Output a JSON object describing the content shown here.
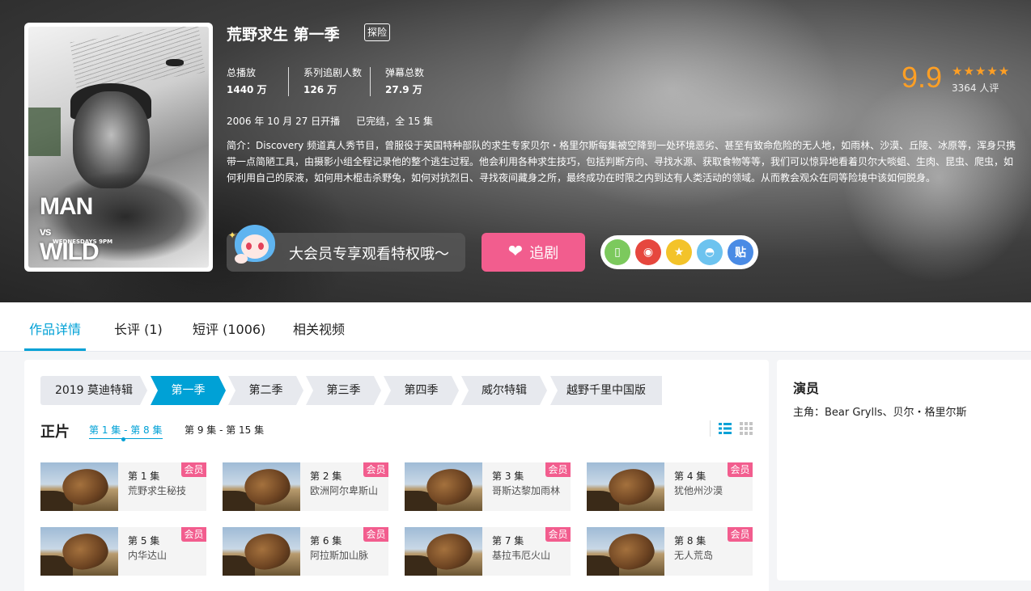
{
  "show": {
    "title": "荒野求生 第一季",
    "genre_tag": "探险",
    "stats": [
      {
        "label": "总播放",
        "value": "1440 万"
      },
      {
        "label": "系列追剧人数",
        "value": "126 万"
      },
      {
        "label": "弹幕总数",
        "value": "27.9 万"
      }
    ],
    "premiere": "2006 年 10 月 27 日开播",
    "status": "已完结，全 15 集",
    "intro": "简介：Discovery 频道真人秀节目，曾服役于英国特种部队的求生专家贝尔・格里尔斯每集被空降到一处环境恶劣、甚至有致命危险的无人地，如雨林、沙漠、丘陵、冰原等，浑身只携带一点简陋工具，由摄影小组全程记录他的整个逃生过程。他会利用各种求生技巧，包括判断方向、寻找水源、获取食物等等，我们可以惊异地看着贝尔大啖蛆、生肉、昆虫、爬虫，如何利用自己的尿液，如何用木棍击杀野兔，如何对抗烈日、寻找夜间藏身之所，最终成功在时限之内到达有人类活动的领域。从而教会观众在同等险境中该如何脱身。",
    "poster": {
      "title_line1": "MAN",
      "title_line2": "vs",
      "title_line3": "WILD",
      "tagline": "WEDNESDAYS 9PM"
    }
  },
  "rating": {
    "score": "9.9",
    "stars": "★★★★★",
    "count": "3364 人评"
  },
  "vip_banner": {
    "text": "大会员专享观看特权哦～"
  },
  "follow_button": {
    "label": "追剧",
    "icon": "heart-icon"
  },
  "share": [
    {
      "name": "mobile-share-icon",
      "glyph": "▯",
      "color": "#7cc95d"
    },
    {
      "name": "weibo-share-icon",
      "glyph": "◉",
      "color": "#e6473e"
    },
    {
      "name": "qzone-share-icon",
      "glyph": "★",
      "color": "#f3c32a"
    },
    {
      "name": "qq-share-icon",
      "glyph": "◓",
      "color": "#6dc3ef"
    },
    {
      "name": "tieba-share-icon",
      "glyph": "贴",
      "color": "#4a8be5"
    }
  ],
  "tabs": [
    {
      "label": "作品详情",
      "active": true
    },
    {
      "label": "长评 (1)",
      "active": false
    },
    {
      "label": "短评 (1006)",
      "active": false
    },
    {
      "label": "相关视频",
      "active": false
    }
  ],
  "seasons": [
    {
      "label": "2019 莫迪特辑",
      "active": false
    },
    {
      "label": "第一季",
      "active": true
    },
    {
      "label": "第二季",
      "active": false
    },
    {
      "label": "第三季",
      "active": false
    },
    {
      "label": "第四季",
      "active": false
    },
    {
      "label": "威尔特辑",
      "active": false
    },
    {
      "label": "越野千里中国版",
      "active": false
    }
  ],
  "episodes_section": {
    "title": "正片",
    "ranges": [
      {
        "label": "第 1 集 - 第 8 集",
        "active": true
      },
      {
        "label": "第 9 集 - 第 15 集",
        "active": false
      }
    ],
    "vip_badge": "会员",
    "episodes": [
      {
        "num": "第 1 集",
        "name": "荒野求生秘技"
      },
      {
        "num": "第 2 集",
        "name": "欧洲阿尔卑斯山"
      },
      {
        "num": "第 3 集",
        "name": "哥斯达黎加雨林"
      },
      {
        "num": "第 4 集",
        "name": "犹他州沙漠"
      },
      {
        "num": "第 5 集",
        "name": "内华达山"
      },
      {
        "num": "第 6 集",
        "name": "阿拉斯加山脉"
      },
      {
        "num": "第 7 集",
        "name": "基拉韦厄火山"
      },
      {
        "num": "第 8 集",
        "name": "无人荒岛"
      }
    ]
  },
  "cast": {
    "title": "演员",
    "line": "主角：Bear Grylls、贝尔・格里尔斯"
  },
  "colors": {
    "accent": "#00a1d6",
    "pink": "#f25d8e",
    "rating": "#ff9f24"
  }
}
